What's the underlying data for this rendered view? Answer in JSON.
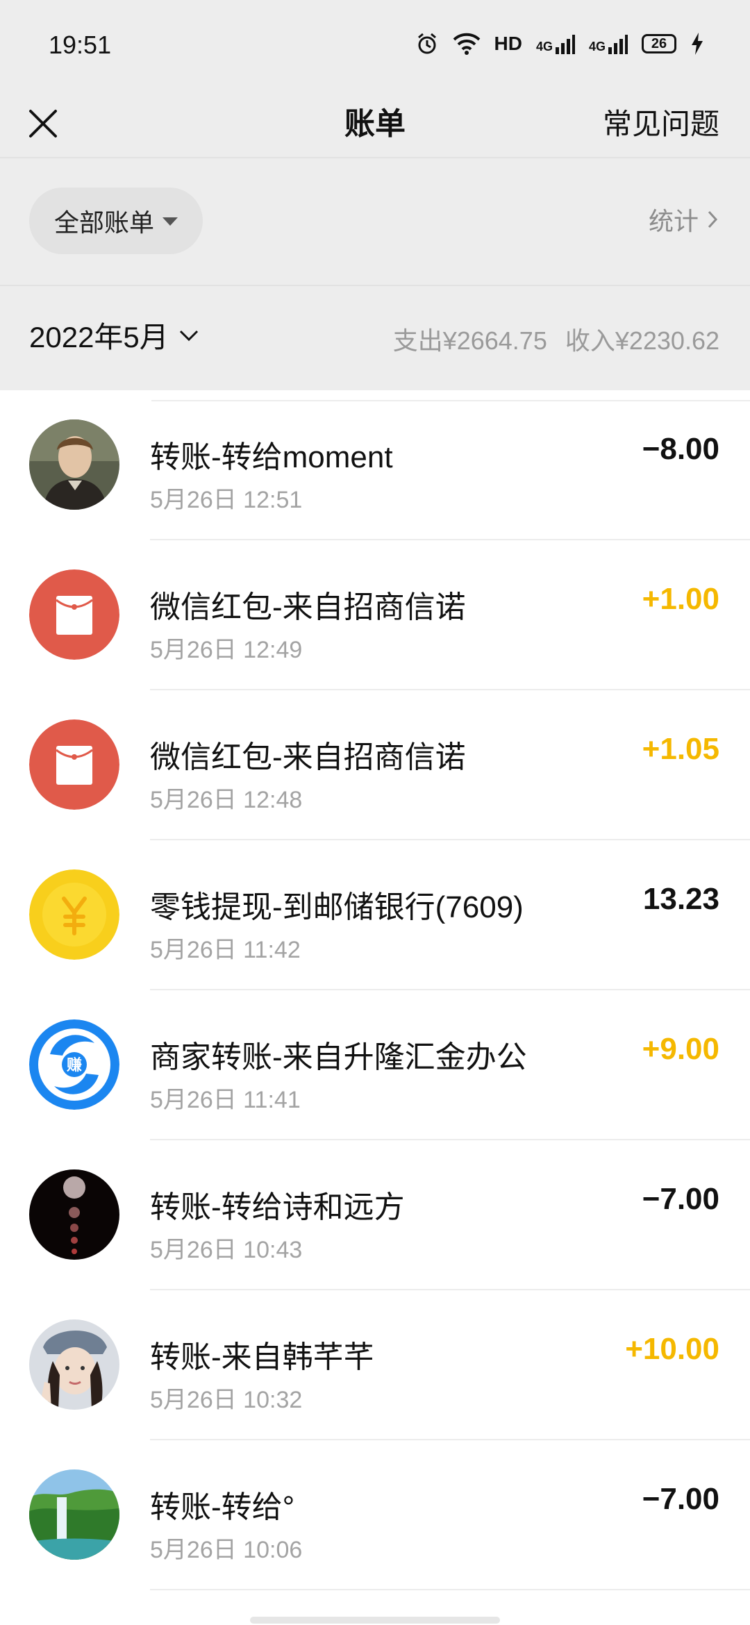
{
  "status_bar": {
    "time": "19:51",
    "network": "HD",
    "signal_1": "4G",
    "signal_2": "4G",
    "battery": "26"
  },
  "header": {
    "title": "账单",
    "faq_label": "常见问题"
  },
  "filter": {
    "label": "全部账单",
    "stats_label": "统计"
  },
  "month": {
    "label": "2022年5月",
    "expense": "支出¥2664.75",
    "income": "收入¥2230.62"
  },
  "transactions": [
    {
      "title": "转账-转给moment",
      "time": "5月26日 12:51",
      "amount": "−8.00",
      "type": "expense",
      "avatar": "person-portrait-avatar"
    },
    {
      "title": "微信红包-来自招商信诺",
      "time": "5月26日 12:49",
      "amount": "+1.00",
      "type": "income",
      "avatar": "red-packet-icon"
    },
    {
      "title": "微信红包-来自招商信诺",
      "time": "5月26日 12:48",
      "amount": "+1.05",
      "type": "income",
      "avatar": "red-packet-icon"
    },
    {
      "title": "零钱提现-到邮储银行(7609)",
      "time": "5月26日 11:42",
      "amount": "13.23",
      "type": "neutral",
      "avatar": "yuan-coin-icon"
    },
    {
      "title": "商家转账-来自升隆汇金办公",
      "time": "5月26日 11:41",
      "amount": "+9.00",
      "type": "income",
      "avatar": "merchant-earn-icon",
      "avatar_text": "赚"
    },
    {
      "title": "转账-转给诗和远方",
      "time": "5月26日 10:43",
      "amount": "−7.00",
      "type": "expense",
      "avatar": "dark-planets-avatar"
    },
    {
      "title": "转账-来自韩芊芊",
      "time": "5月26日 10:32",
      "amount": "+10.00",
      "type": "income",
      "avatar": "girl-selfie-avatar"
    },
    {
      "title": "转账-转给°",
      "time": "5月26日 10:06",
      "amount": "−7.00",
      "type": "expense",
      "avatar": "waterfall-landscape-avatar"
    }
  ],
  "colors": {
    "income": "#f5b800",
    "expense": "#111111",
    "red_packet": "#e05a4a",
    "coin": "#f8cf1c",
    "merchant": "#1b86f0",
    "header_bg": "#ededed"
  }
}
